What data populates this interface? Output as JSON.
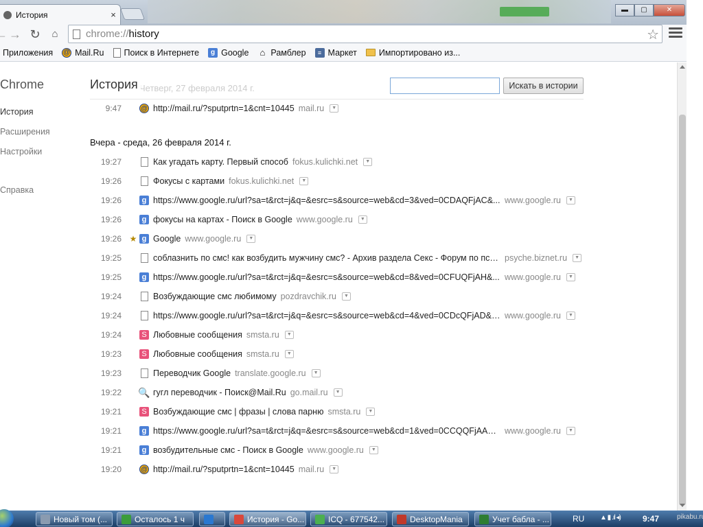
{
  "browser": {
    "tab_title": "История",
    "tab_close": "×",
    "url_scheme": "chrome://",
    "url_path": "history",
    "window_controls": {
      "minimize": "▬",
      "maximize": "▢",
      "close": "✕"
    }
  },
  "bookmarks": [
    {
      "label": "Приложения",
      "icon": "apps-grid-icon"
    },
    {
      "label": "Mail.Ru",
      "icon": "mailru-icon"
    },
    {
      "label": "Поиск в Интернете",
      "icon": "page-icon"
    },
    {
      "label": "Google",
      "icon": "google-icon"
    },
    {
      "label": "Рамблер",
      "icon": "house-icon"
    },
    {
      "label": "Маркет",
      "icon": "market-icon"
    },
    {
      "label": "Импортировано из...",
      "icon": "folder-icon"
    }
  ],
  "sidebar": {
    "brand": "Chrome",
    "items": [
      {
        "label": "История",
        "active": true
      },
      {
        "label": "Расширения",
        "active": false
      },
      {
        "label": "Настройки",
        "active": false
      },
      {
        "label": "Справка",
        "active": false
      }
    ]
  },
  "main": {
    "title": "История",
    "ghost_date": "Четверг, 27 февраля 2014 г.",
    "search_placeholder": "",
    "search_button": "Искать в истории",
    "today_entries": [
      {
        "time": "9:47",
        "icon": "mailru",
        "title": "http://mail.ru/?sputprtn=1&cnt=10445",
        "domain": "mail.ru",
        "starred": false,
        "long": false
      }
    ],
    "yesterday_heading": "Вчера - среда, 26 февраля 2014 г.",
    "yesterday_entries": [
      {
        "time": "19:27",
        "icon": "doc",
        "title": "Как угадать карту. Первый способ",
        "domain": "fokus.kulichki.net",
        "starred": false,
        "long": false
      },
      {
        "time": "19:26",
        "icon": "doc",
        "title": "Фокусы с картами",
        "domain": "fokus.kulichki.net",
        "starred": false,
        "long": false
      },
      {
        "time": "19:26",
        "icon": "google",
        "title": "https://www.google.ru/url?sa=t&rct=j&q=&esrc=s&source=web&cd=3&ved=0CDAQFjAC&...",
        "domain": "www.google.ru",
        "starred": false,
        "long": true
      },
      {
        "time": "19:26",
        "icon": "google",
        "title": "фокусы на картах - Поиск в Google",
        "domain": "www.google.ru",
        "starred": false,
        "long": false
      },
      {
        "time": "19:26",
        "icon": "google",
        "title": "Google",
        "domain": "www.google.ru",
        "starred": true,
        "long": false
      },
      {
        "time": "19:25",
        "icon": "doc",
        "title": "соблазнить по смс! как возбудить мужчину смс? - Архив раздела Секс - Форум по психо...",
        "domain": "psyche.biznet.ru",
        "starred": false,
        "long": true
      },
      {
        "time": "19:25",
        "icon": "google",
        "title": "https://www.google.ru/url?sa=t&rct=j&q=&esrc=s&source=web&cd=8&ved=0CFUQFjAH&...",
        "domain": "www.google.ru",
        "starred": false,
        "long": true
      },
      {
        "time": "19:24",
        "icon": "doc",
        "title": "Возбуждающие смс любимому",
        "domain": "pozdravchik.ru",
        "starred": false,
        "long": false
      },
      {
        "time": "19:24",
        "icon": "doc",
        "title": "https://www.google.ru/url?sa=t&rct=j&q=&esrc=s&source=web&cd=4&ved=0CDcQFjAD&u...",
        "domain": "www.google.ru",
        "starred": false,
        "long": true
      },
      {
        "time": "19:24",
        "icon": "smsta",
        "title": "Любовные сообщения",
        "domain": "smsta.ru",
        "starred": false,
        "long": false
      },
      {
        "time": "19:23",
        "icon": "smsta",
        "title": "Любовные сообщения",
        "domain": "smsta.ru",
        "starred": false,
        "long": false
      },
      {
        "time": "19:23",
        "icon": "doc",
        "title": "Переводчик Google",
        "domain": "translate.google.ru",
        "starred": false,
        "long": false
      },
      {
        "time": "19:22",
        "icon": "gomail",
        "title": "гугл переводчик - Поиск@Mail.Ru",
        "domain": "go.mail.ru",
        "starred": false,
        "long": false
      },
      {
        "time": "19:21",
        "icon": "smsta",
        "title": "Возбуждающие смс | фразы | слова парню",
        "domain": "smsta.ru",
        "starred": false,
        "long": false
      },
      {
        "time": "19:21",
        "icon": "google",
        "title": "https://www.google.ru/url?sa=t&rct=j&q=&esrc=s&source=web&cd=1&ved=0CCQQFjAA&...",
        "domain": "www.google.ru",
        "starred": false,
        "long": true
      },
      {
        "time": "19:21",
        "icon": "google",
        "title": "возбудительные смс - Поиск в Google",
        "domain": "www.google.ru",
        "starred": false,
        "long": false
      },
      {
        "time": "19:20",
        "icon": "mailru",
        "title": "http://mail.ru/?sputprtn=1&cnt=10445",
        "domain": "mail.ru",
        "starred": false,
        "long": false
      }
    ]
  },
  "taskbar": {
    "items": [
      {
        "label": "Новый том (...",
        "icon": "drive-icon",
        "color": "#8a9bb0",
        "active": false
      },
      {
        "label": "Осталось 1 ч",
        "icon": "copy-progress-icon",
        "color": "#3b9c3b",
        "active": false
      },
      {
        "label": "",
        "icon": "ie-icon",
        "color": "#2a78d0",
        "active": false
      },
      {
        "label": "История - Go...",
        "icon": "chrome-icon",
        "color": "#d9483b",
        "active": true
      },
      {
        "label": "ICQ - 677542...",
        "icon": "icq-icon",
        "color": "#4caf50",
        "active": false
      },
      {
        "label": "DesktopMania",
        "icon": "opera-icon",
        "color": "#c0392b",
        "active": false
      },
      {
        "label": "Учет бабла - ...",
        "icon": "excel-icon",
        "color": "#2e7d32",
        "active": false
      }
    ],
    "language": "RU",
    "clock": "9:47",
    "watermark": "pikabu.ru"
  }
}
